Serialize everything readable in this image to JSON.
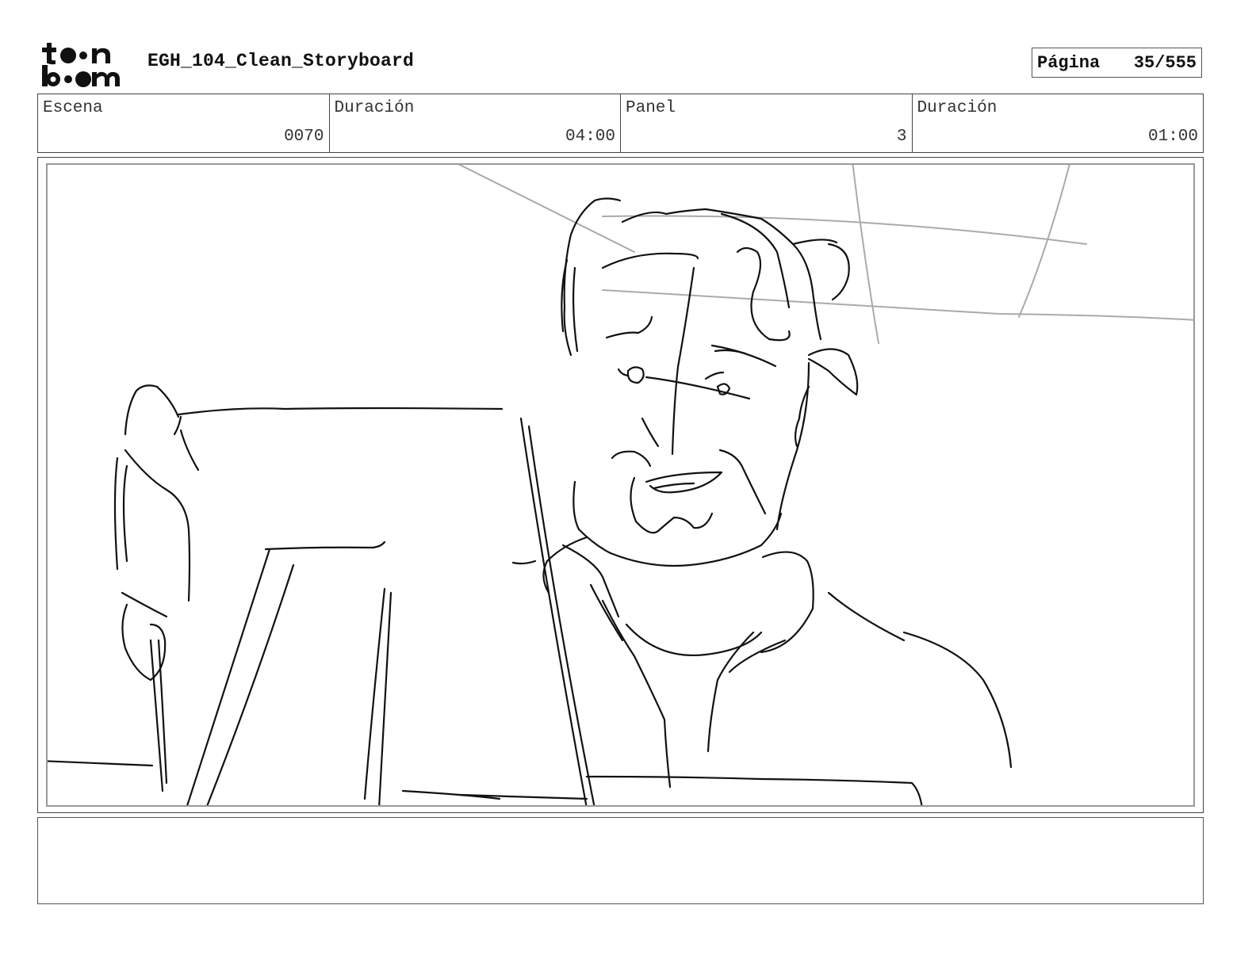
{
  "header": {
    "logo_icon": "toon-boom-logo",
    "doc_title": "EGH_104_Clean_Storyboard",
    "page_label": "Página",
    "page_value": "35/555"
  },
  "info": {
    "scene_label": "Escena",
    "scene_value": "0070",
    "scene_duration_label": "Duración",
    "scene_duration_value": "04:00",
    "panel_label": "Panel",
    "panel_value": "3",
    "panel_duration_label": "Duración",
    "panel_duration_value": "01:00"
  },
  "panel": {
    "image": "sketch-man-smiling-holding-paper"
  },
  "notes": {
    "text": ""
  }
}
